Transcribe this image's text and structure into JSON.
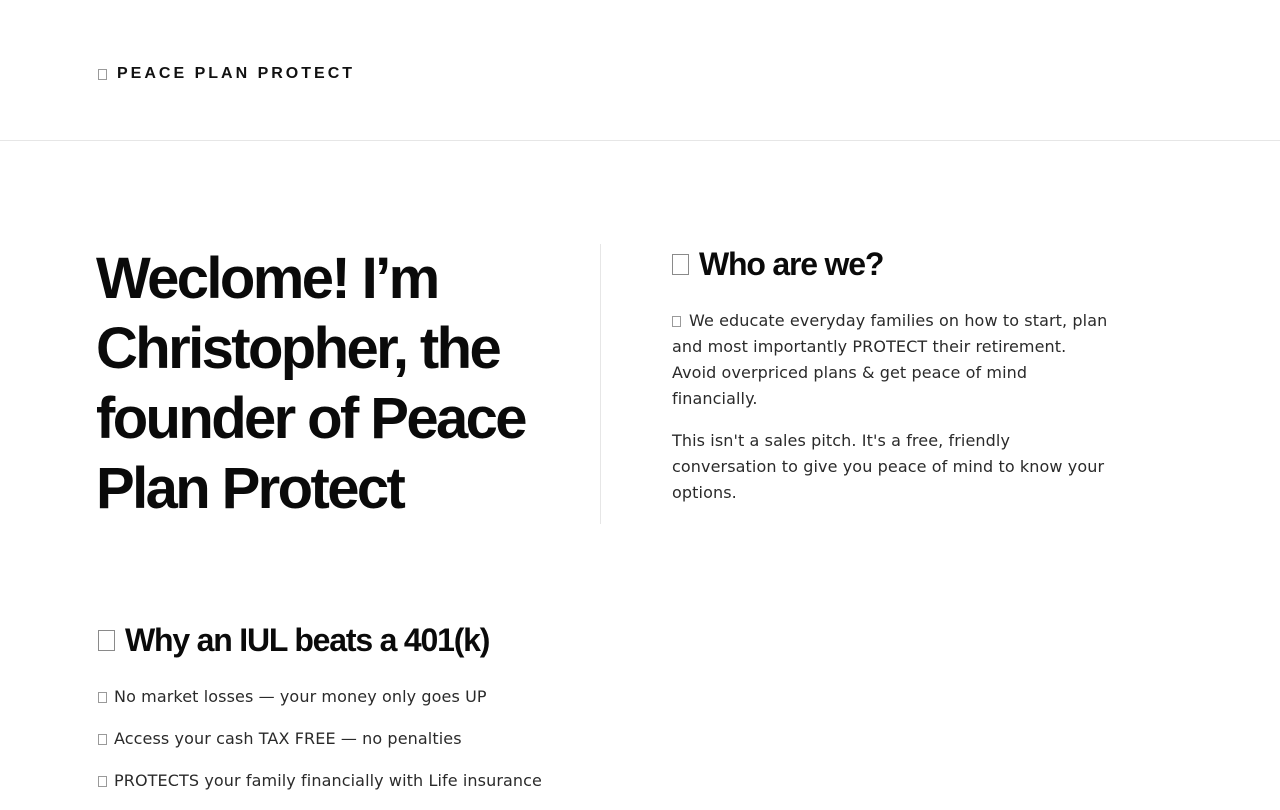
{
  "header": {
    "brand_icon": "box-glyph-icon",
    "brand_name": "PEACE PLAN PROTECT"
  },
  "hero": {
    "title": "Weclome! I’m Christopher, the founder of Peace Plan Protect"
  },
  "who": {
    "heading_icon": "box-glyph-icon",
    "heading": "Who are we?",
    "paragraph1": "We educate everyday families on how to start, plan and most importantly PROTECT their retirement. Avoid overpriced plans & get peace of mind financially.",
    "paragraph2": "This isn't a sales pitch. It's a free, friendly conversation to give you peace of mind to know your options."
  },
  "why": {
    "heading_icon": "box-glyph-icon",
    "heading": "Why an IUL beats a 401(k)",
    "items": [
      {
        "icon": "box-glyph-icon",
        "text": "No market losses — your money only goes UP"
      },
      {
        "icon": "box-glyph-icon",
        "text": "Access your cash TAX FREE — no penalties"
      },
      {
        "icon": "box-glyph-icon",
        "text": "PROTECTS your family financially with Life insurance"
      }
    ]
  }
}
